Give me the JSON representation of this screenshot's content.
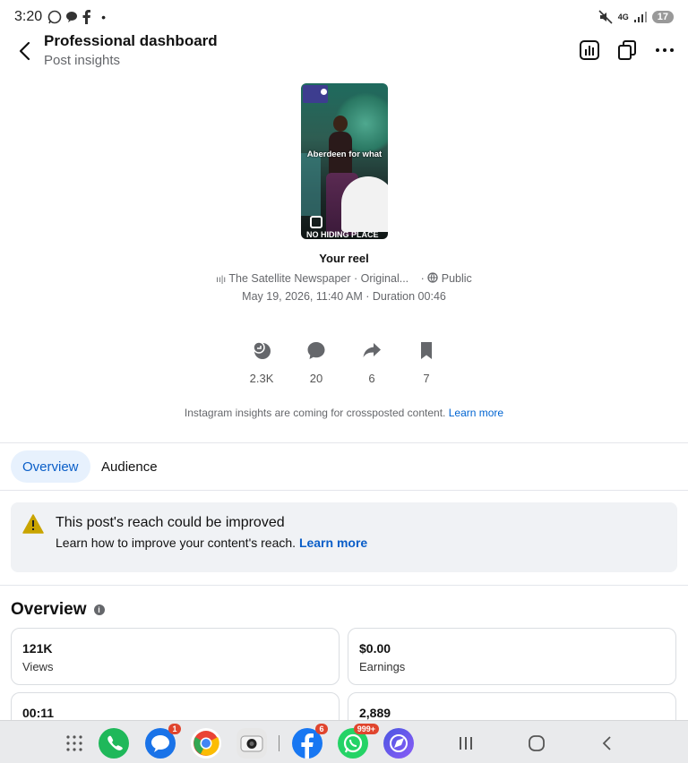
{
  "status_bar": {
    "time": "3:20",
    "network": "4G",
    "battery": "17"
  },
  "header": {
    "title": "Professional dashboard",
    "subtitle": "Post insights"
  },
  "reel": {
    "overlay_text": "Aberdeen for what",
    "bottom_text": "NO HIDING PLACE",
    "title": "Your reel",
    "source": "The Satellite Newspaper · Original...",
    "audience": "Public",
    "meta": "May 19, 2026, 11:40 AM · Duration 00:46"
  },
  "engagement": {
    "reactions": "2.3K",
    "comments": "20",
    "shares": "6",
    "saves": "7"
  },
  "notice": {
    "text": "Instagram insights are coming for crossposted content.",
    "link": "Learn more"
  },
  "tabs": [
    {
      "label": "Overview",
      "active": true
    },
    {
      "label": "Audience",
      "active": false
    }
  ],
  "banner": {
    "title": "This post's reach could be improved",
    "text": "Learn how to improve your content's reach.",
    "link": "Learn more"
  },
  "overview": {
    "title": "Overview",
    "cards": [
      {
        "value": "121K",
        "label": "Views"
      },
      {
        "value": "$0.00",
        "label": "Earnings"
      },
      {
        "value": "00:11",
        "label": ""
      },
      {
        "value": "2,889",
        "label": ""
      }
    ]
  },
  "navbar": {
    "messages_badge": "1",
    "facebook_badge": "6",
    "whatsapp_badge": "999+"
  },
  "colors": {
    "accent": "#0a5ec8",
    "tab_active_bg": "#e7f1fd",
    "warning": "#c9a400"
  }
}
